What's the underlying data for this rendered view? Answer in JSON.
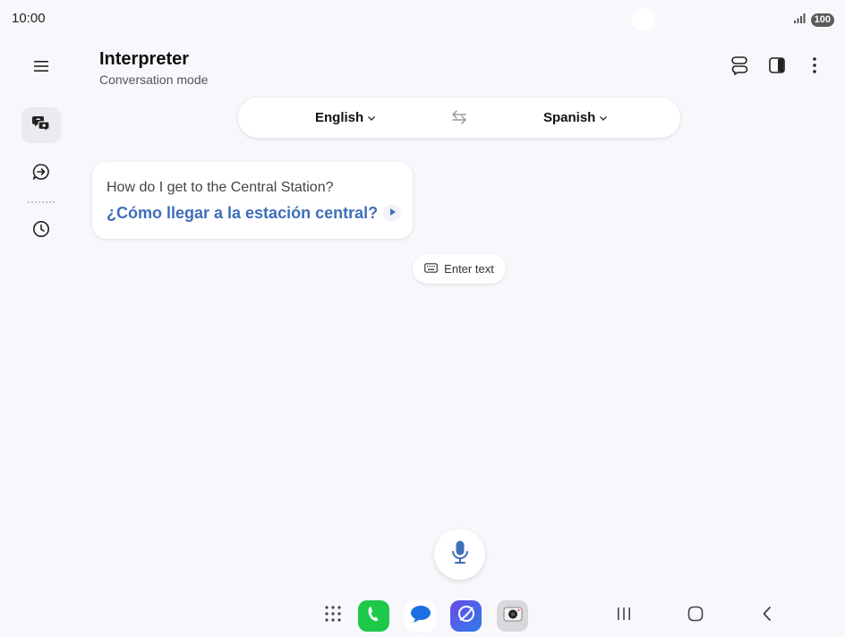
{
  "status": {
    "time": "10:00",
    "battery": "100"
  },
  "header": {
    "title": "Interpreter",
    "subtitle": "Conversation mode"
  },
  "languages": {
    "source": "English",
    "target": "Spanish"
  },
  "conversation": [
    {
      "original": "How do I get to the Central Station?",
      "translation": "¿Cómo llegar a la estación central?"
    }
  ],
  "input": {
    "enter_text_label": "Enter text"
  },
  "icons": {
    "rail": [
      "menu-icon",
      "conversation-icon",
      "text-translate-icon",
      "history-icon"
    ],
    "header_actions": [
      "split-conversation-icon",
      "side-panel-icon",
      "more-options-icon"
    ],
    "dock": [
      "app-drawer-icon",
      "phone-app-icon",
      "messages-app-icon",
      "internet-app-icon",
      "camera-app-icon"
    ],
    "navbar": [
      "recents-icon",
      "home-icon",
      "back-icon"
    ]
  },
  "colors": {
    "accent": "#3e6fb8",
    "background": "#f8f7fb"
  }
}
